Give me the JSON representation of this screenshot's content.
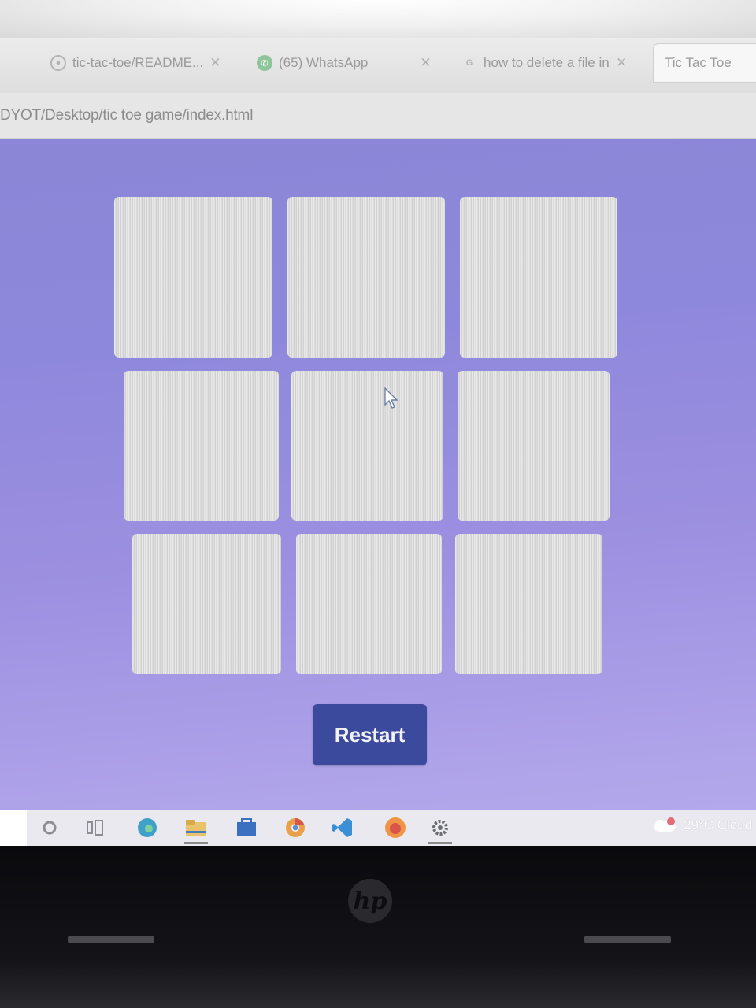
{
  "browser": {
    "tabs": [
      {
        "label": "tic-tac-toe/README...",
        "favicon": "github-icon",
        "close": "✕"
      },
      {
        "label": "(65) WhatsApp",
        "favicon": "whatsapp-icon",
        "close": "✕"
      },
      {
        "label": "how to delete a file in",
        "favicon": "google-icon",
        "close": "✕"
      },
      {
        "label": "Tic Tac Toe",
        "favicon": "",
        "close": ""
      }
    ],
    "address": "DYOT/Desktop/tic toe game/index.html"
  },
  "game": {
    "cells": [
      "",
      "",
      "",
      "",
      "",
      "",
      "",
      "",
      ""
    ],
    "restart_label": "Restart"
  },
  "taskbar": {
    "icons": [
      "cortana-icon",
      "task-view-icon",
      "edge-icon",
      "file-explorer-icon",
      "store-icon",
      "chrome-icon",
      "vscode-icon",
      "firefox-icon",
      "settings-icon"
    ],
    "weather_text": "29°C  Cloud"
  },
  "colors": {
    "page_background": "#8e88dc",
    "cell": "#dcdcdc",
    "button": "#3b4a9c"
  }
}
